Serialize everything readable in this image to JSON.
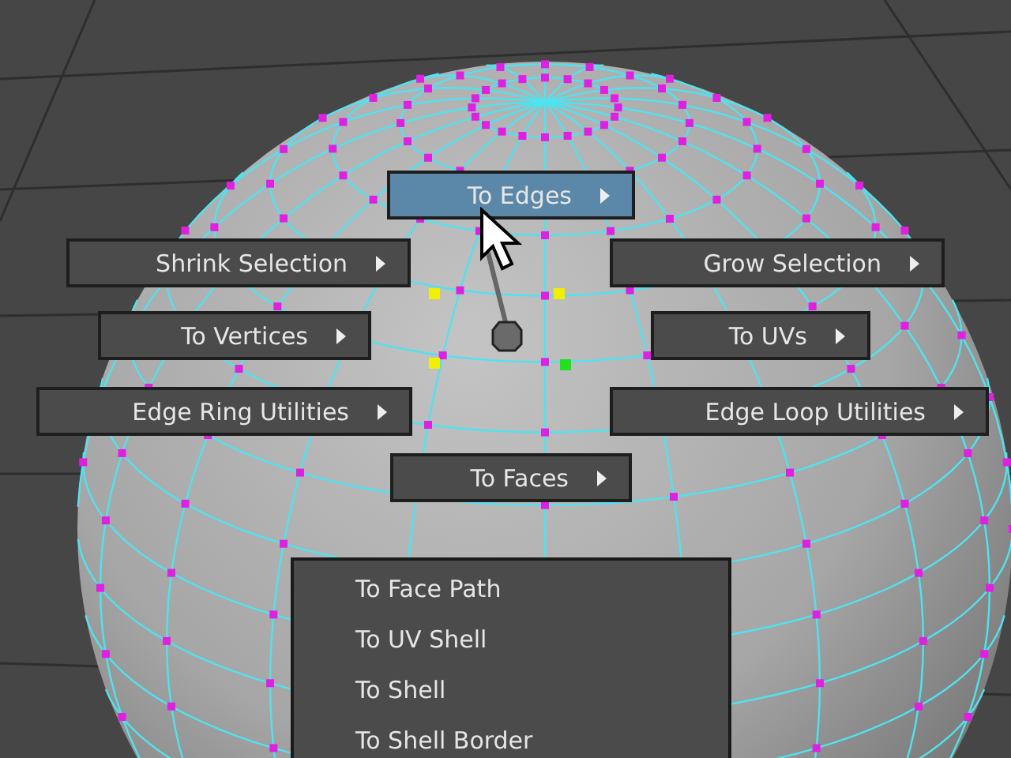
{
  "marking_menu": {
    "north": {
      "label": "To Edges",
      "selected": true
    },
    "north_west": {
      "label": "Shrink Selection",
      "selected": false
    },
    "north_east": {
      "label": "Grow Selection",
      "selected": false
    },
    "west": {
      "label": "To Vertices",
      "selected": false
    },
    "east": {
      "label": "To UVs",
      "selected": false
    },
    "south_west": {
      "label": "Edge Ring Utilities",
      "selected": false
    },
    "south_east": {
      "label": "Edge Loop Utilities",
      "selected": false
    },
    "south": {
      "label": "To Faces",
      "selected": false
    }
  },
  "submenu": {
    "items": [
      {
        "label": "To Face Path"
      },
      {
        "label": "To UV Shell"
      },
      {
        "label": "To Shell"
      },
      {
        "label": "To Shell Border"
      }
    ]
  }
}
